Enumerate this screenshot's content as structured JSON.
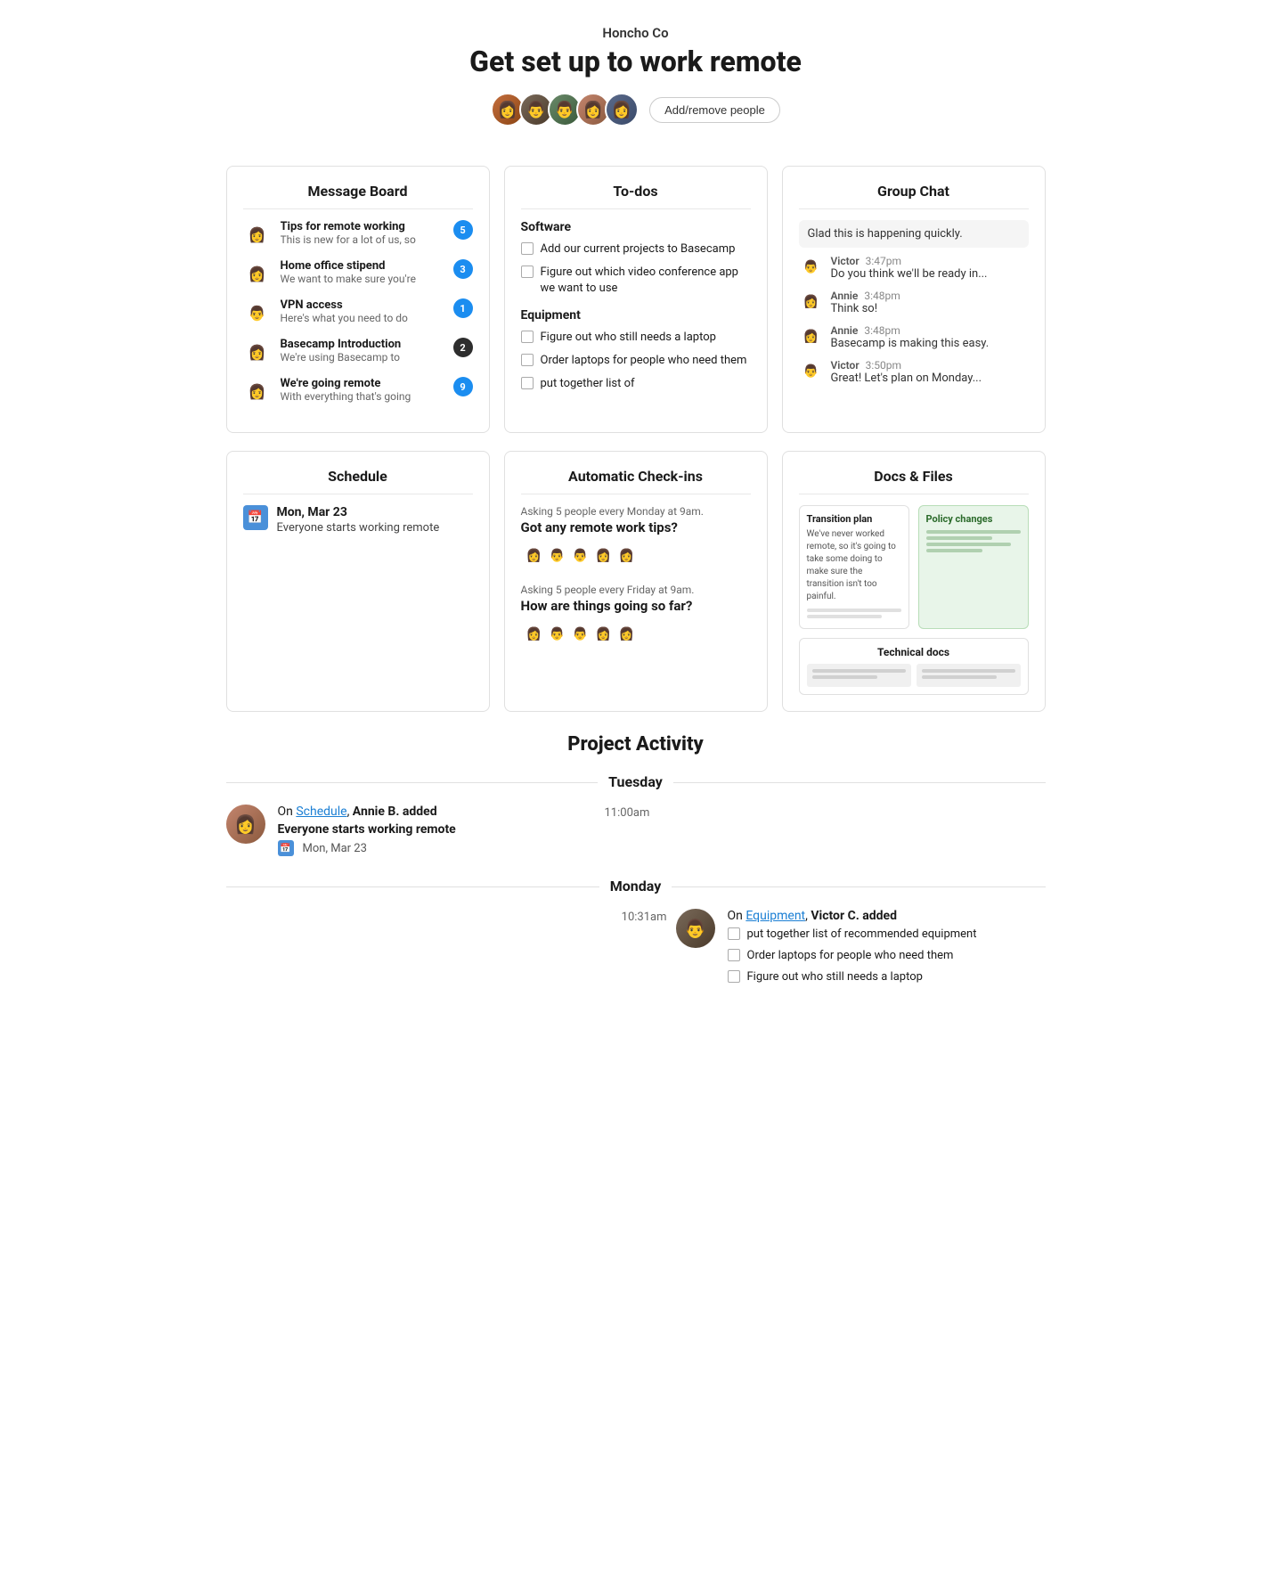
{
  "header": {
    "company": "Honcho Co",
    "title": "Get set up to work remote",
    "add_people_label": "Add/remove people"
  },
  "message_board": {
    "title": "Message Board",
    "messages": [
      {
        "title": "Tips for remote working",
        "preview": "This is new for a lot of us, so",
        "badge": "5",
        "badge_color": "blue",
        "avatar": "av1"
      },
      {
        "title": "Home office stipend",
        "preview": "We want to make sure you're",
        "badge": "3",
        "badge_color": "blue",
        "avatar": "av2"
      },
      {
        "title": "VPN access",
        "preview": "Here's what you need to do",
        "badge": "1",
        "badge_color": "blue",
        "avatar": "av3"
      },
      {
        "title": "Basecamp Introduction",
        "preview": "We're using Basecamp to",
        "badge": "2",
        "badge_color": "dark",
        "avatar": "av4"
      },
      {
        "title": "We're going remote",
        "preview": "With everything that's going",
        "badge": "9",
        "badge_color": "blue",
        "avatar": "av5"
      }
    ]
  },
  "todos": {
    "title": "To-dos",
    "sections": [
      {
        "section_title": "Software",
        "items": [
          "Add our current projects to Basecamp",
          "Figure out which video conference app we want to use"
        ]
      },
      {
        "section_title": "Equipment",
        "items": [
          "Figure out who still needs a laptop",
          "Order laptops for people who need them",
          "put together list of"
        ]
      }
    ]
  },
  "group_chat": {
    "title": "Group Chat",
    "messages": [
      {
        "anonymous": true,
        "text": "Glad this is happening quickly.",
        "avatar": "av1"
      },
      {
        "name": "Victor",
        "time": "3:47pm",
        "text": "Do you think we'll be ready in...",
        "avatar": "av2"
      },
      {
        "name": "Annie",
        "time": "3:48pm",
        "text": "Think so!",
        "avatar": "av4"
      },
      {
        "name": "Annie",
        "time": "3:48pm",
        "text": "Basecamp is making this easy.",
        "avatar": "av4"
      },
      {
        "name": "Victor",
        "time": "3:50pm",
        "text": "Great! Let's plan on Monday...",
        "avatar": "av2"
      }
    ]
  },
  "schedule": {
    "title": "Schedule",
    "events": [
      {
        "date": "Mon, Mar 23",
        "description": "Everyone starts working remote"
      }
    ]
  },
  "auto_checkins": {
    "title": "Automatic Check-ins",
    "checkins": [
      {
        "frequency": "Asking 5 people every Monday at 9am.",
        "question": "Got any remote work tips?"
      },
      {
        "frequency": "Asking 5 people every Friday at 9am.",
        "question": "How are things going so far?"
      }
    ]
  },
  "docs_files": {
    "title": "Docs & Files",
    "docs": [
      {
        "title": "Transition plan",
        "body": "We've never worked remote, so it's going to take some doing to make sure the transition isn't too painful.",
        "type": "white"
      },
      {
        "title": "Policy changes",
        "type": "green"
      },
      {
        "title": "Technical docs",
        "type": "bottom"
      }
    ]
  },
  "project_activity": {
    "title": "Project Activity",
    "days": [
      {
        "day": "Tuesday",
        "events": [
          {
            "side": "left",
            "time": "11:00am",
            "user": "Annie B.",
            "section": "Schedule",
            "action": "added",
            "item_title": "Everyone starts working remote",
            "item_sub": "Mon, Mar 23",
            "avatar": "annie"
          }
        ]
      },
      {
        "day": "Monday",
        "events": [
          {
            "side": "right",
            "time": "10:31am",
            "user": "Victor C.",
            "section": "Equipment",
            "action": "added",
            "todos": [
              "put together list of recommended equipment",
              "Order laptops for people who need them",
              "Figure out who still needs a laptop"
            ],
            "avatar": "victor"
          }
        ]
      }
    ]
  }
}
